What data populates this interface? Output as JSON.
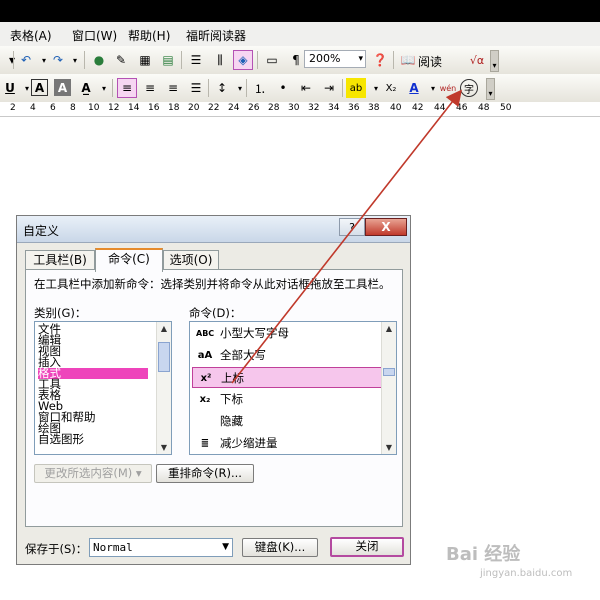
{
  "menu": {
    "items": [
      "表格(A)",
      "窗口(W)",
      "帮助(H)",
      "福昕阅读器"
    ]
  },
  "toolbar1": {
    "zoom": "200%",
    "reader_label": "阅读",
    "formula_glyph": "√α"
  },
  "toolbar2": {
    "underline": "U",
    "char_border": "A",
    "char_shading": "A",
    "highlight": "ab",
    "subscript": "X₂",
    "font_color": "A",
    "pinyin": "wén",
    "enclose_char": "字"
  },
  "ruler": {
    "numbers": [
      "2",
      "4",
      "6",
      "8",
      "10",
      "12",
      "14",
      "16",
      "18",
      "20",
      "22",
      "24",
      "26",
      "28",
      "30",
      "32",
      "34",
      "36",
      "38",
      "40",
      "42",
      "44",
      "46",
      "48",
      "50"
    ]
  },
  "dialog": {
    "title": "自定义",
    "help_glyph": "?",
    "close_glyph": "X",
    "tabs": [
      "工具栏(B)",
      "命令(C)",
      "选项(O)"
    ],
    "description": "在工具栏中添加新命令：选择类别并将命令从此对话框拖放至工具栏。",
    "categories_label": "类别(G)：",
    "commands_label": "命令(D)：",
    "categories": [
      "文件",
      "编辑",
      "视图",
      "插入",
      "格式",
      "工具",
      "表格",
      "Web",
      "窗口和帮助",
      "绘图",
      "自选图形"
    ],
    "selected_category": "格式",
    "commands": [
      {
        "icon": "ABC",
        "label": "小型大写字母"
      },
      {
        "icon": "aA",
        "label": "全部大写"
      },
      {
        "icon": "x²",
        "label": "上标"
      },
      {
        "icon": "x₂",
        "label": "下标"
      },
      {
        "icon": "",
        "label": "隐藏"
      },
      {
        "icon": "≣",
        "label": "减少缩进量"
      }
    ],
    "selected_command": "上标",
    "modify_selection_button": "更改所选内容(M) ▾",
    "rearrange_button": "重排命令(R)...",
    "save_in_label": "保存于(S)：",
    "save_in_value": "Normal",
    "keyboard_button": "键盘(K)...",
    "close_button": "关闭"
  },
  "watermark": {
    "brand": "Bai 经验",
    "url": "jingyan.baidu.com"
  },
  "colors": {
    "highlight_border": "#b452b4",
    "selection_pink": "#ee44bb",
    "arrow_red": "#c0392b"
  }
}
